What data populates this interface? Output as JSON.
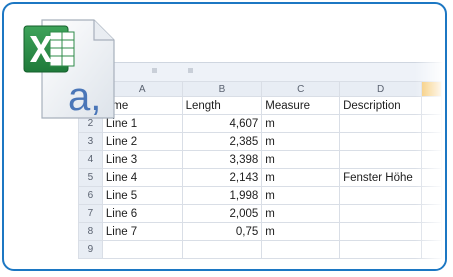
{
  "columns": [
    "A",
    "B",
    "C",
    "D"
  ],
  "header_row": {
    "num": "",
    "a": "ame",
    "b": "Length",
    "c": "Measure",
    "d": "Description"
  },
  "rows": [
    {
      "num": "2",
      "a": "Line 1",
      "b": "4,607",
      "c": "m",
      "d": ""
    },
    {
      "num": "3",
      "a": "Line 2",
      "b": "2,385",
      "c": "m",
      "d": ""
    },
    {
      "num": "4",
      "a": "Line 3",
      "b": "3,398",
      "c": "m",
      "d": ""
    },
    {
      "num": "5",
      "a": "Line 4",
      "b": "2,143",
      "c": "m",
      "d": "Fenster Höhe"
    },
    {
      "num": "6",
      "a": "Line 5",
      "b": "1,998",
      "c": "m",
      "d": ""
    },
    {
      "num": "7",
      "a": "Line 6",
      "b": "2,005",
      "c": "m",
      "d": ""
    },
    {
      "num": "8",
      "a": "Line 7",
      "b": "0,75",
      "c": "m",
      "d": ""
    },
    {
      "num": "9",
      "a": "",
      "b": "",
      "c": "",
      "d": ""
    }
  ],
  "icon": {
    "glyph": "a,",
    "name": "excel-file-icon"
  },
  "colors": {
    "frame": "#1c77c3",
    "excel_green": "#1f7a3a",
    "glyph_blue": "#4a76b8",
    "selected_col": "#f5c66b"
  }
}
